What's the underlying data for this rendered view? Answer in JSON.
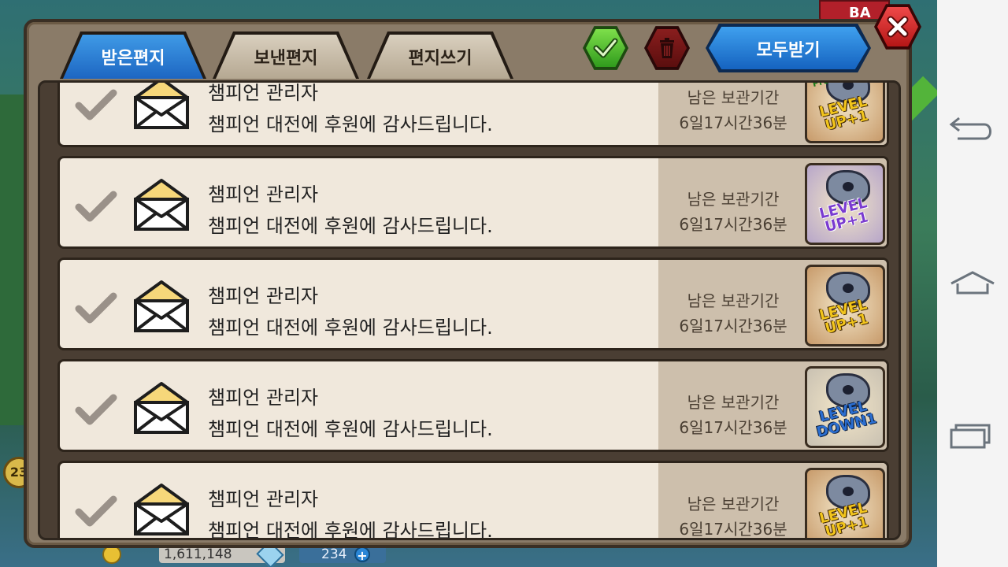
{
  "panel": {
    "tabs": [
      {
        "label": "받은편지",
        "active": true
      },
      {
        "label": "보낸편지",
        "active": false
      },
      {
        "label": "편지쓰기",
        "active": false
      }
    ],
    "actions": {
      "select_all_icon": "green-check-icon",
      "delete_icon": "trash-icon",
      "receive_all_label": "모두받기",
      "close_icon": "close-icon"
    }
  },
  "mails": [
    {
      "sender": "챔피언 관리자",
      "message": "챔피언 대전에 후원에 감사드립니다.",
      "remain_label": "남은 보관기간",
      "remain_time": "6일17시간36분",
      "reward": {
        "lines": [
          "LEVEL",
          "UP+1"
        ],
        "premium": "Premium!",
        "style": "up"
      }
    },
    {
      "sender": "챔피언 관리자",
      "message": "챔피언 대전에 후원에 감사드립니다.",
      "remain_label": "남은 보관기간",
      "remain_time": "6일17시간36분",
      "reward": {
        "lines": [
          "LEVEL",
          "UP+1"
        ],
        "style": "up-purple"
      }
    },
    {
      "sender": "챔피언 관리자",
      "message": "챔피언 대전에 후원에 감사드립니다.",
      "remain_label": "남은 보관기간",
      "remain_time": "6일17시간36분",
      "reward": {
        "lines": [
          "LEVEL",
          "UP+1"
        ],
        "style": "up"
      }
    },
    {
      "sender": "챔피언 관리자",
      "message": "챔피언 대전에 후원에 감사드립니다.",
      "remain_label": "남은 보관기간",
      "remain_time": "6일17시간36분",
      "reward": {
        "lines": [
          "LEVEL",
          "DOWN1"
        ],
        "style": "down"
      }
    },
    {
      "sender": "챔피언 관리자",
      "message": "챔피언 대전에 후원에 감사드립니다.",
      "remain_label": "남은 보관기간",
      "remain_time": "6일17시간36분",
      "reward": {
        "lines": [
          "LEVEL",
          "UP+1"
        ],
        "style": "up"
      }
    }
  ],
  "hud": {
    "gold": "1,611,148",
    "gems": "234",
    "gem_plus": "+",
    "left_token": "23",
    "top_ribbon": "BA"
  },
  "colors": {
    "tab_active": "#1d66c2",
    "confirm_green": "#2f9a1c",
    "delete_red": "#5a0e0e",
    "close_red": "#b31515",
    "row_bg": "#f0e8dc",
    "row_side": "#cdbfac"
  },
  "nav": {
    "back_icon": "back-icon",
    "home_icon": "home-icon",
    "recents_icon": "recents-icon"
  }
}
